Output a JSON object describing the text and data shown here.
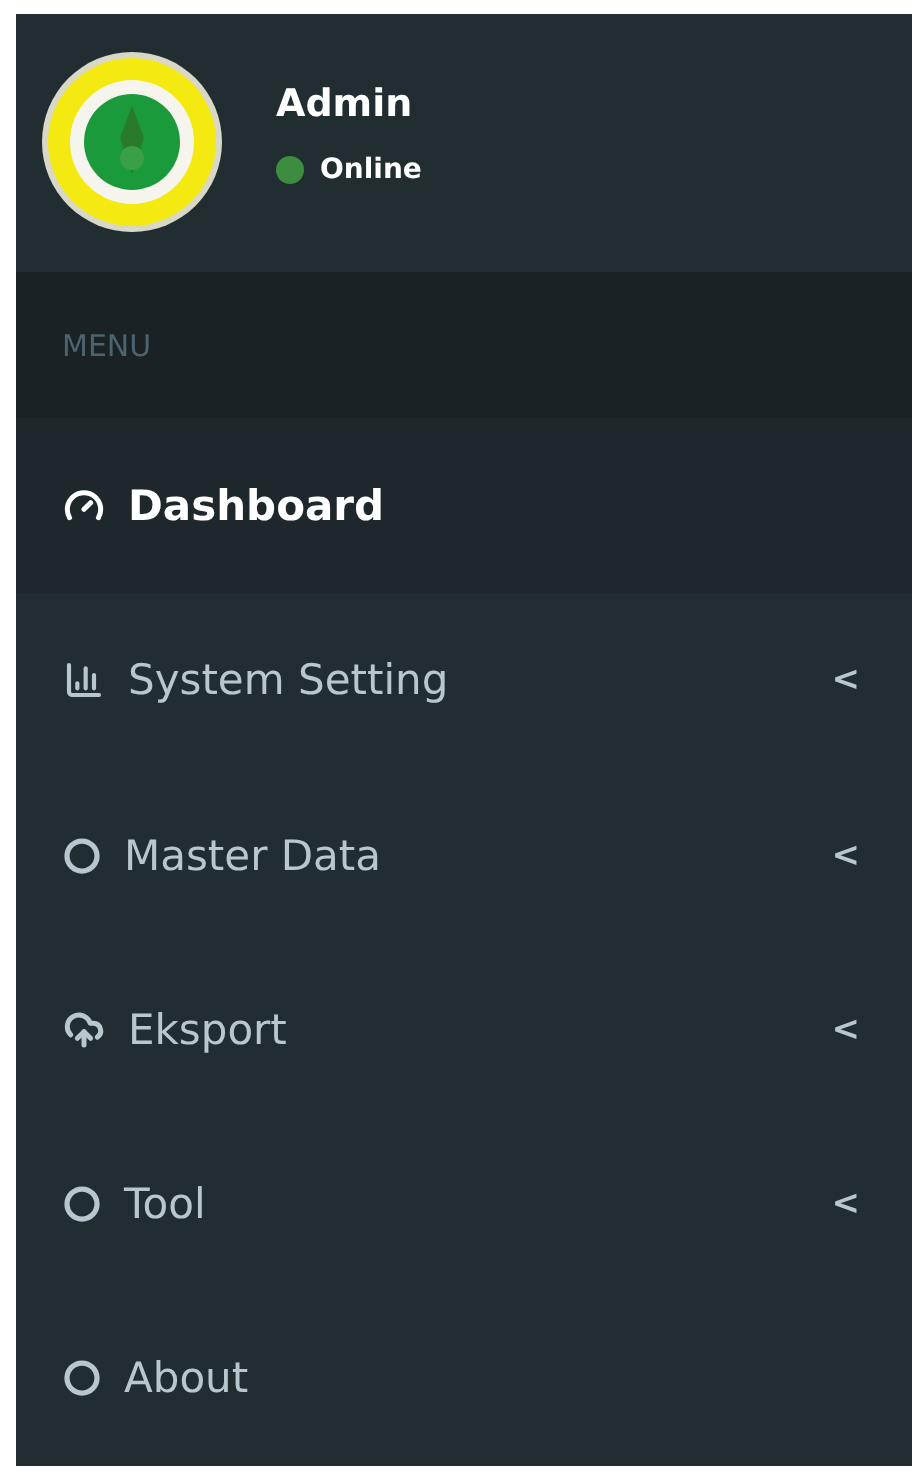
{
  "user": {
    "name": "Admin",
    "status": "Online"
  },
  "menu_header": "MENU",
  "menu": [
    {
      "label": "Dashboard",
      "selected": true
    },
    {
      "label": "System Setting",
      "selected": false,
      "caret": "<"
    },
    {
      "label": "Master Data",
      "selected": false,
      "caret": "<"
    },
    {
      "label": "Eksport",
      "selected": false,
      "caret": "<"
    },
    {
      "label": "Tool",
      "selected": false,
      "caret": "<"
    },
    {
      "label": "About",
      "selected": false
    }
  ]
}
